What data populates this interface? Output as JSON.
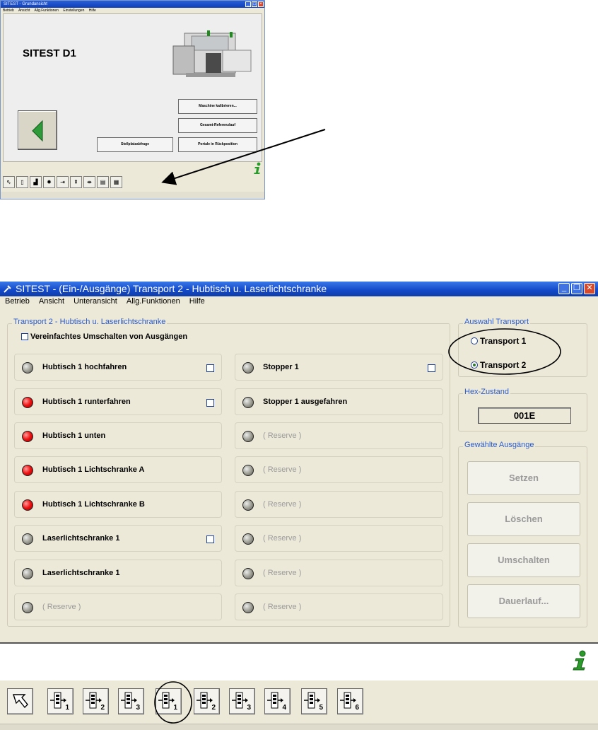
{
  "top_window": {
    "title": "SITEST - Grundansicht",
    "menu": [
      "Betrieb",
      "Ansicht",
      "Allg.Funktionen",
      "Einstellungen",
      "Hilfe"
    ],
    "heading": "SITEST D1",
    "buttons": {
      "calibrate": "Maschine kalibrieren...",
      "reference": "Gesamt-Referenzlauf",
      "station": "Stellplatzabfrage",
      "portal": "Portale in Rückposition"
    }
  },
  "window": {
    "title": "SITEST - (Ein-/Ausgänge) Transport 2 - Hubtisch u. Laserlichtschranke",
    "menu": [
      "Betrieb",
      "Ansicht",
      "Unteransicht",
      "Allg.Funktionen",
      "Hilfe"
    ]
  },
  "io_group": {
    "legend": "Transport 2 - Hubtisch u. Laserlichtschranke",
    "simplified_label": "Vereinfachtes Umschalten von Ausgängen",
    "left": [
      {
        "label": "Hubtisch 1 hochfahren",
        "state": "off",
        "checkbox": true
      },
      {
        "label": "Hubtisch 1 runterfahren",
        "state": "on",
        "checkbox": true
      },
      {
        "label": "Hubtisch 1 unten",
        "state": "on",
        "checkbox": false
      },
      {
        "label": "Hubtisch 1 Lichtschranke A",
        "state": "on",
        "checkbox": false
      },
      {
        "label": "Hubtisch 1 Lichtschranke B",
        "state": "on",
        "checkbox": false
      },
      {
        "label": "Laserlichtschranke 1",
        "state": "off",
        "checkbox": true
      },
      {
        "label": "Laserlichtschranke 1",
        "state": "off",
        "checkbox": false
      },
      {
        "label": "( Reserve )",
        "state": "off",
        "checkbox": false,
        "reserve": true
      }
    ],
    "right": [
      {
        "label": "Stopper 1",
        "state": "off",
        "checkbox": true
      },
      {
        "label": "Stopper 1 ausgefahren",
        "state": "off",
        "checkbox": false
      },
      {
        "label": "( Reserve )",
        "state": "off",
        "checkbox": false,
        "reserve": true
      },
      {
        "label": "( Reserve )",
        "state": "off",
        "checkbox": false,
        "reserve": true
      },
      {
        "label": "( Reserve )",
        "state": "off",
        "checkbox": false,
        "reserve": true
      },
      {
        "label": "( Reserve )",
        "state": "off",
        "checkbox": false,
        "reserve": true
      },
      {
        "label": "( Reserve )",
        "state": "off",
        "checkbox": false,
        "reserve": true
      },
      {
        "label": "( Reserve )",
        "state": "off",
        "checkbox": false,
        "reserve": true
      }
    ]
  },
  "transport_group": {
    "legend": "Auswahl Transport",
    "option1": "Transport 1",
    "option2": "Transport 2",
    "selected": "Transport 2"
  },
  "hex_group": {
    "legend": "Hex-Zustand",
    "value": "001E"
  },
  "outputs_group": {
    "legend": "Gewählte Ausgänge",
    "set": "Setzen",
    "clear": "Löschen",
    "toggle": "Umschalten",
    "continuous": "Dauerlauf..."
  },
  "toolbar": {
    "buttons": [
      "1",
      "2",
      "3",
      "1",
      "2",
      "3",
      "4",
      "5",
      "6"
    ]
  },
  "colors": {
    "led_on": "#ee1010",
    "led_off": "#9a9a90",
    "annotation": "#000000",
    "legend_text": "#2b5bcc"
  }
}
